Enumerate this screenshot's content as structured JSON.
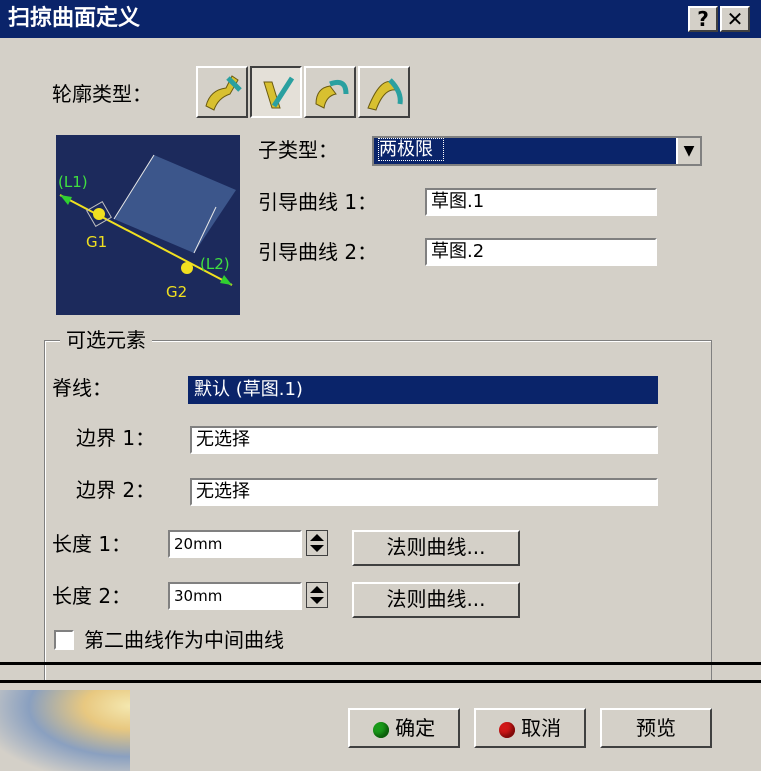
{
  "window": {
    "title": "扫掠曲面定义",
    "help_label": "?",
    "close_label": "✕"
  },
  "profile": {
    "label": "轮廓类型：",
    "icons": [
      "profile-explicit-icon",
      "profile-line-icon",
      "profile-circle-icon",
      "profile-conic-icon"
    ],
    "selected_index": 1
  },
  "preview": {
    "labels": {
      "l1": "(L1)",
      "l2": "(L2)",
      "g1": "G1",
      "g2": "G2"
    }
  },
  "subtype": {
    "label": "子类型：",
    "value": "两极限"
  },
  "guide1": {
    "label": "引导曲线 1：",
    "value": "草图.1"
  },
  "guide2": {
    "label": "引导曲线 2：",
    "value": "草图.2"
  },
  "optional": {
    "legend": "可选元素",
    "spine": {
      "label": "脊线：",
      "value": "默认 (草图.1)"
    },
    "boundary1": {
      "label": "边界 1：",
      "value": "无选择"
    },
    "boundary2": {
      "label": "边界 2：",
      "value": "无选择"
    },
    "length1": {
      "label": "长度 1：",
      "value": "20mm",
      "law_button": "法则曲线..."
    },
    "length2": {
      "label": "长度 2：",
      "value": "30mm",
      "law_button": "法则曲线..."
    },
    "middle_curve": {
      "label": "第二曲线作为中间曲线",
      "checked": false
    }
  },
  "footer": {
    "ok_label": "确定",
    "cancel_label": "取消",
    "preview_label": "预览"
  },
  "colors": {
    "titlebar": "#0a246a",
    "selection": "#0a246a",
    "preview_bg": "#1c2a5c",
    "ok_dot": "#1a9a1a",
    "cancel_dot": "#d01818"
  }
}
